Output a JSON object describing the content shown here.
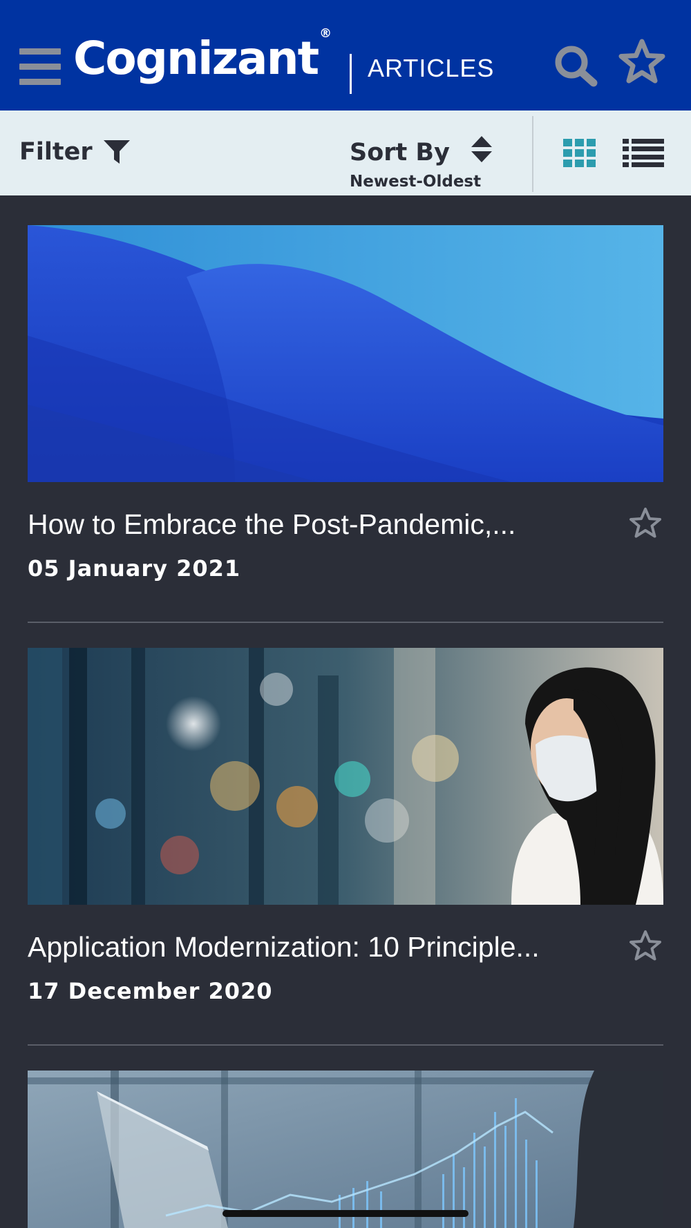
{
  "header": {
    "brand": "Cognizant",
    "brand_mark": "®",
    "section": "ARTICLES",
    "icons": [
      "menu-icon",
      "search-icon",
      "star-icon"
    ],
    "colors": {
      "background": "#0033a1",
      "icon": "#8a8f99"
    }
  },
  "toolbar": {
    "filter_label": "Filter",
    "sort_label": "Sort By",
    "sort_value": "Newest-Oldest",
    "view_modes": [
      "grid-view",
      "list-view"
    ],
    "active_view": "grid-view",
    "colors": {
      "background": "#e4eef2",
      "active": "#2c9cae"
    }
  },
  "articles": [
    {
      "title": "How to Embrace the Post-Pandemic,...",
      "date": "05 January 2021",
      "favorite": false
    },
    {
      "title": "Application Modernization: 10 Principle...",
      "date": "17 December 2020",
      "favorite": false
    },
    {
      "title": "",
      "date": "",
      "favorite": false
    }
  ]
}
